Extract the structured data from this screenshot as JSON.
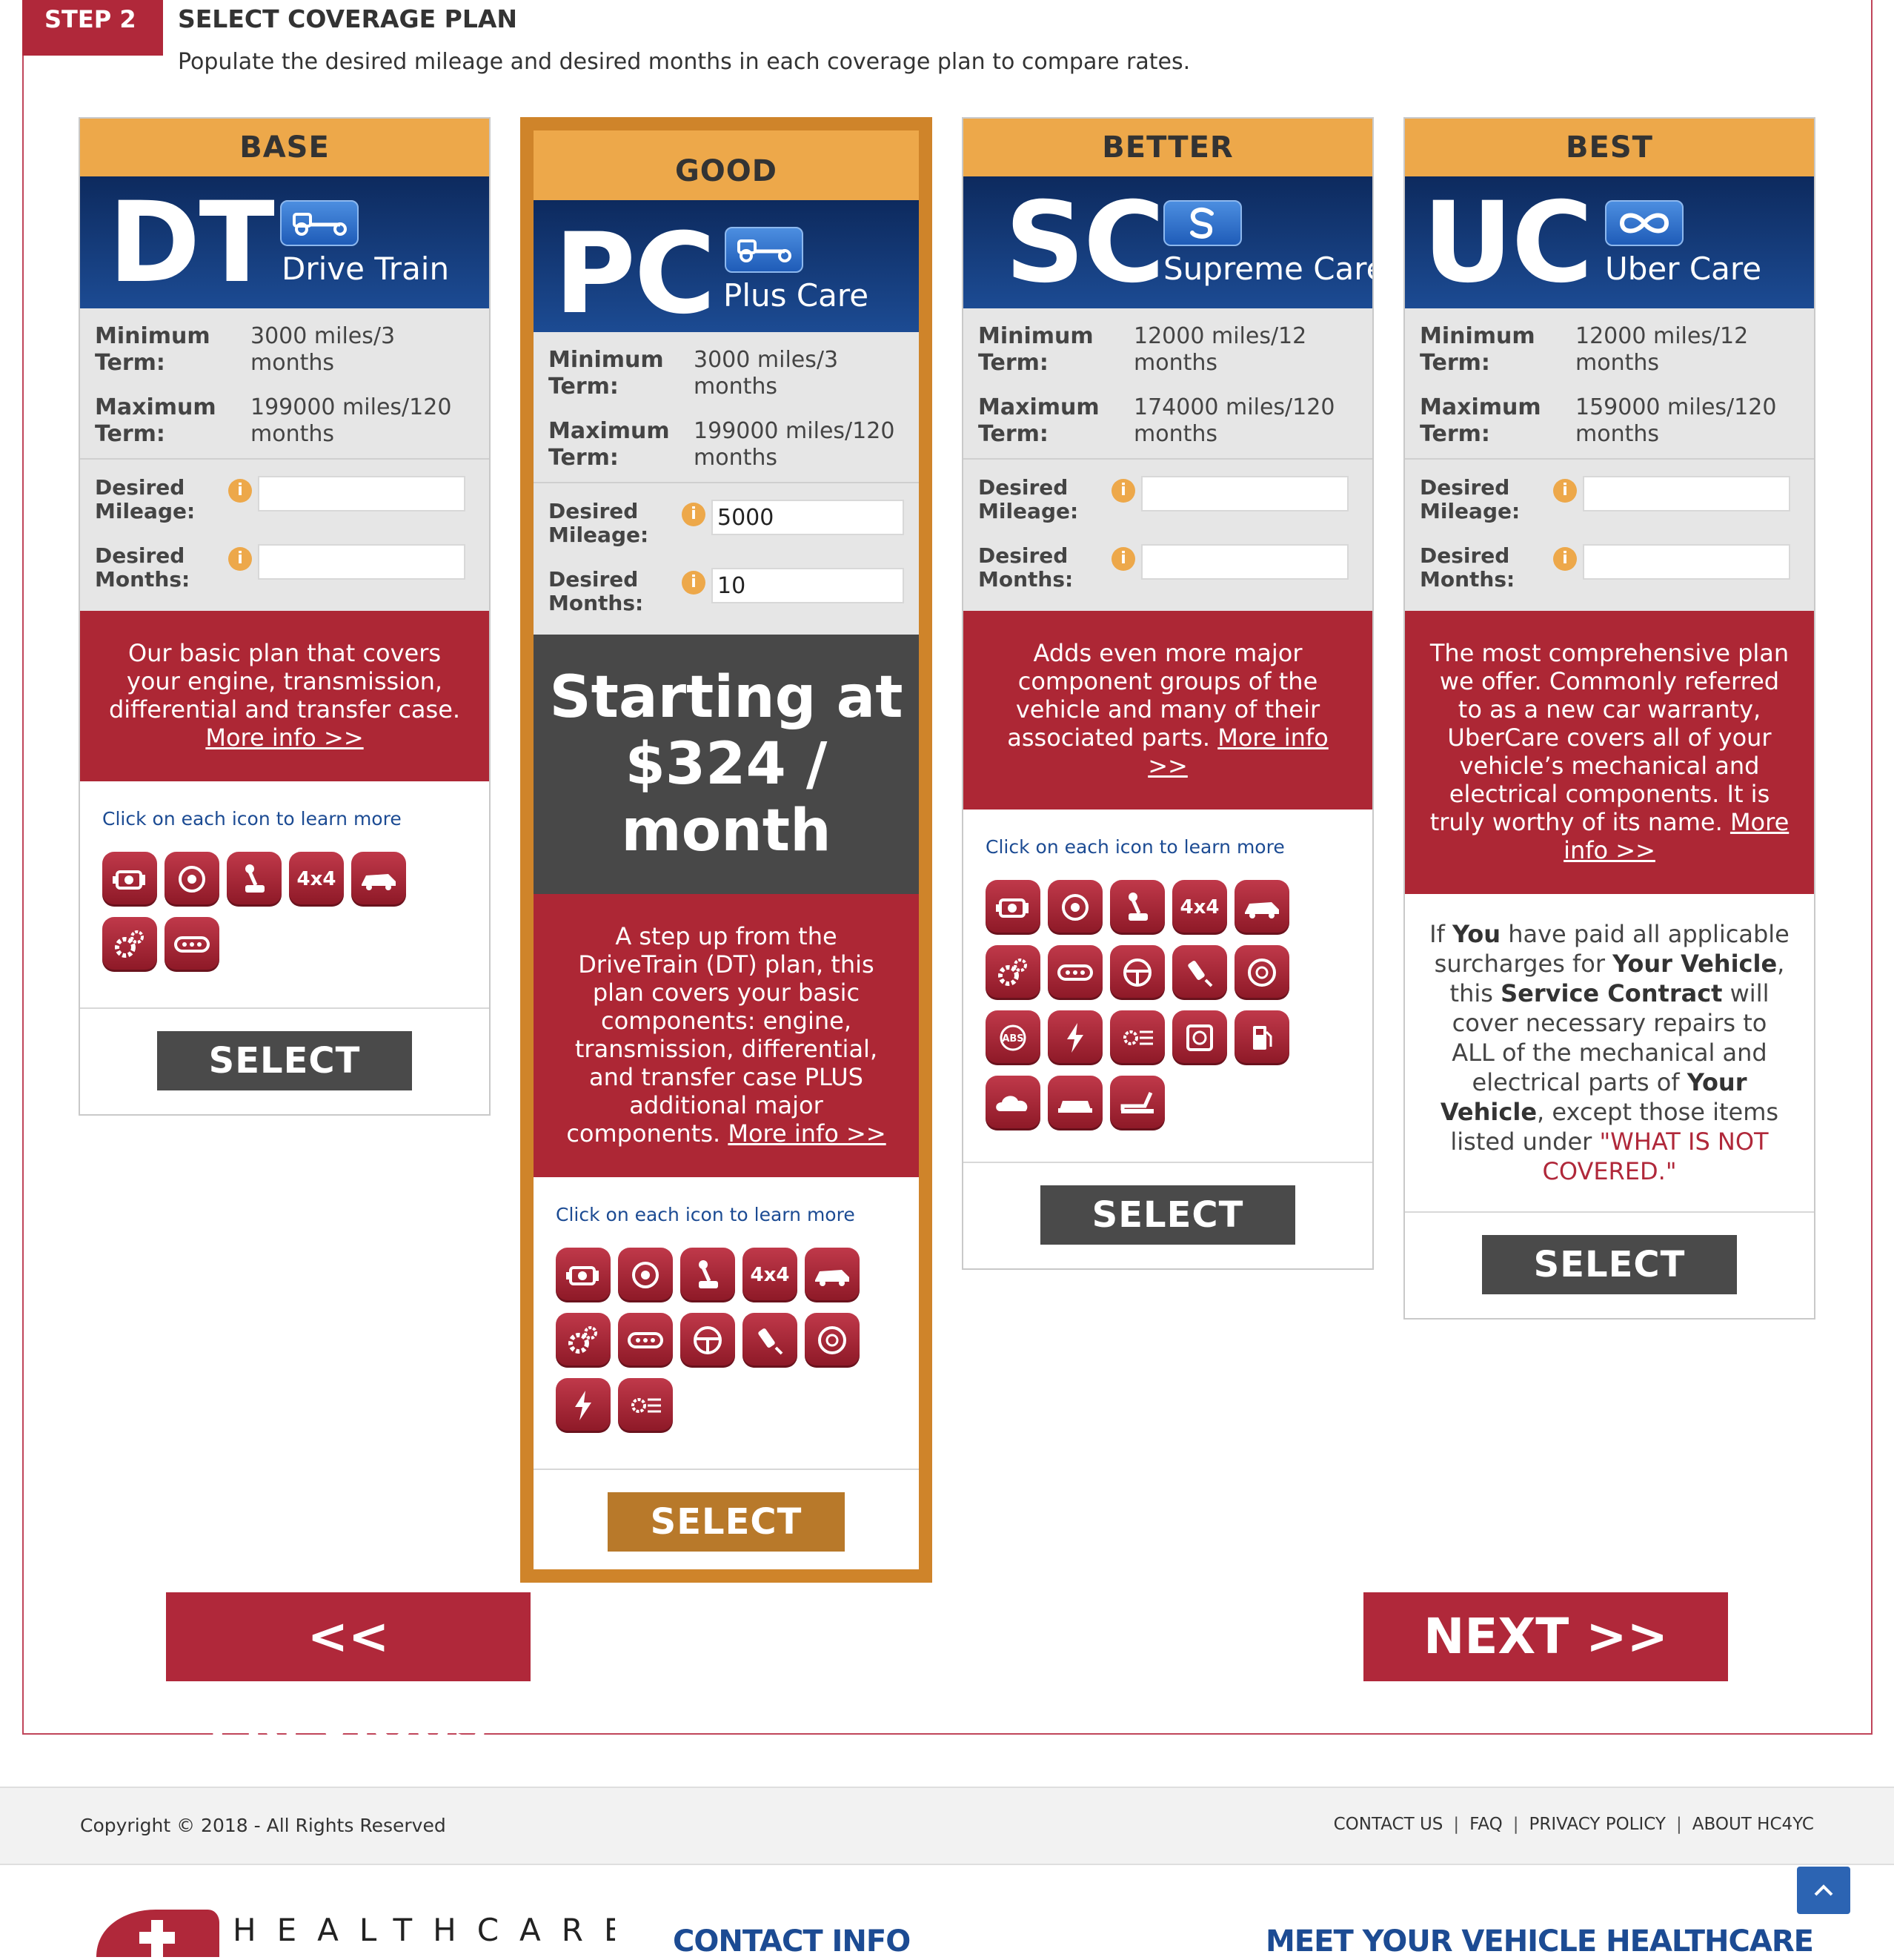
{
  "step": {
    "badge": "STEP 2",
    "title": "SELECT COVERAGE PLAN",
    "subtitle": "Populate the desired mileage and desired months in each coverage plan to compare rates."
  },
  "labels": {
    "minimum_term": "Minimum Term:",
    "maximum_term": "Maximum Term:",
    "desired_mileage": "Desired Mileage:",
    "desired_months": "Desired Months:",
    "icons_hint": "Click on each icon to learn more",
    "select": "SELECT",
    "more_info": "More info >>",
    "info_glyph": "i"
  },
  "plans": [
    {
      "tier": "BASE",
      "code": "DT",
      "name": "Drive Train",
      "logo_icon": "tow-truck-icon",
      "min_term": "3000 miles/3 months",
      "max_term": "199000 miles/120 months",
      "desired_mileage": "",
      "desired_months": "",
      "description": "Our basic plan that covers your engine, transmission, differential and transfer case.",
      "icons": [
        "engine-icon",
        "turbo-icon",
        "gear-shift-icon",
        "4x4-icon",
        "car-electric-icon",
        "gears-icon",
        "chain-icon"
      ]
    },
    {
      "tier": "GOOD",
      "code": "PC",
      "name": "Plus Care",
      "logo_icon": "tow-truck-icon",
      "min_term": "3000 miles/3 months",
      "max_term": "199000 miles/120 months",
      "desired_mileage": "5000",
      "desired_months": "10",
      "price_line1": "Starting at",
      "price_line2": "$324 / month",
      "description": "A step up from the DriveTrain (DT) plan, this plan covers your basic components: engine, transmission, differential, and transfer case PLUS additional major components.",
      "icons": [
        "engine-icon",
        "turbo-icon",
        "gear-shift-icon",
        "4x4-icon",
        "car-electric-icon",
        "gears-icon",
        "chain-icon",
        "steering-wheel-icon",
        "spark-plug-icon",
        "brake-disc-icon",
        "lightning-icon",
        "ac-icon"
      ]
    },
    {
      "tier": "BETTER",
      "code": "SC",
      "name": "Supreme Care",
      "logo_icon": "s-swirl-icon",
      "min_term": "12000 miles/12 months",
      "max_term": "174000 miles/120 months",
      "desired_mileage": "",
      "desired_months": "",
      "description": "Adds even more major component groups of the vehicle and many of their associated parts.",
      "icons": [
        "engine-icon",
        "turbo-icon",
        "gear-shift-icon",
        "4x4-icon",
        "car-electric-icon",
        "gears-icon",
        "chain-icon",
        "steering-wheel-icon",
        "spark-plug-icon",
        "brake-disc-icon",
        "abs-icon",
        "lightning-icon",
        "ac-icon",
        "radiator-icon",
        "fuel-pump-icon",
        "cloud-icon",
        "car-front-icon",
        "seat-icon"
      ]
    },
    {
      "tier": "BEST",
      "code": "UC",
      "name": "Uber Care",
      "logo_icon": "infinity-icon",
      "min_term": "12000 miles/12 months",
      "max_term": "159000 miles/120 months",
      "desired_mileage": "",
      "desired_months": "",
      "description": "The most comprehensive plan we offer. Commonly referred to as a new car warranty, UberCare covers all of your vehicle’s mechanical and electrical components. It is truly worthy of its name.",
      "more_info_a": "More",
      "more_info_b": "info >>",
      "exclusion": {
        "p1": "If ",
        "b1": "You",
        "p2": " have paid all applicable surcharges for ",
        "b2": "Your Vehicle",
        "p3": ", this ",
        "b3": "Service Contract",
        "p4": " will cover necessary repairs to ALL of the mechanical and electrical parts of ",
        "b4": "Your Vehicle",
        "p5": ", except those items listed under ",
        "red": "\"WHAT IS NOT COVERED.\""
      }
    }
  ],
  "nav": {
    "previous": "<< PREVIOUS",
    "next": "NEXT >>"
  },
  "footer": {
    "copyright": "Copyright © 2018 - All Rights Reserved",
    "links": [
      "CONTACT US",
      "FAQ",
      "PRIVACY POLICY",
      "ABOUT HC4YC"
    ],
    "separator": "|",
    "logo_text": "HEALTHCARE",
    "contact_heading": "CONTACT INFO",
    "provider_heading": "MEET YOUR VEHICLE HEALTHCARE PROVIDER"
  },
  "colors": {
    "brand_red": "#b0283a",
    "tier_orange": "#eda84a",
    "featured_border": "#cf842a",
    "banner_blue": "#1c4b93"
  }
}
